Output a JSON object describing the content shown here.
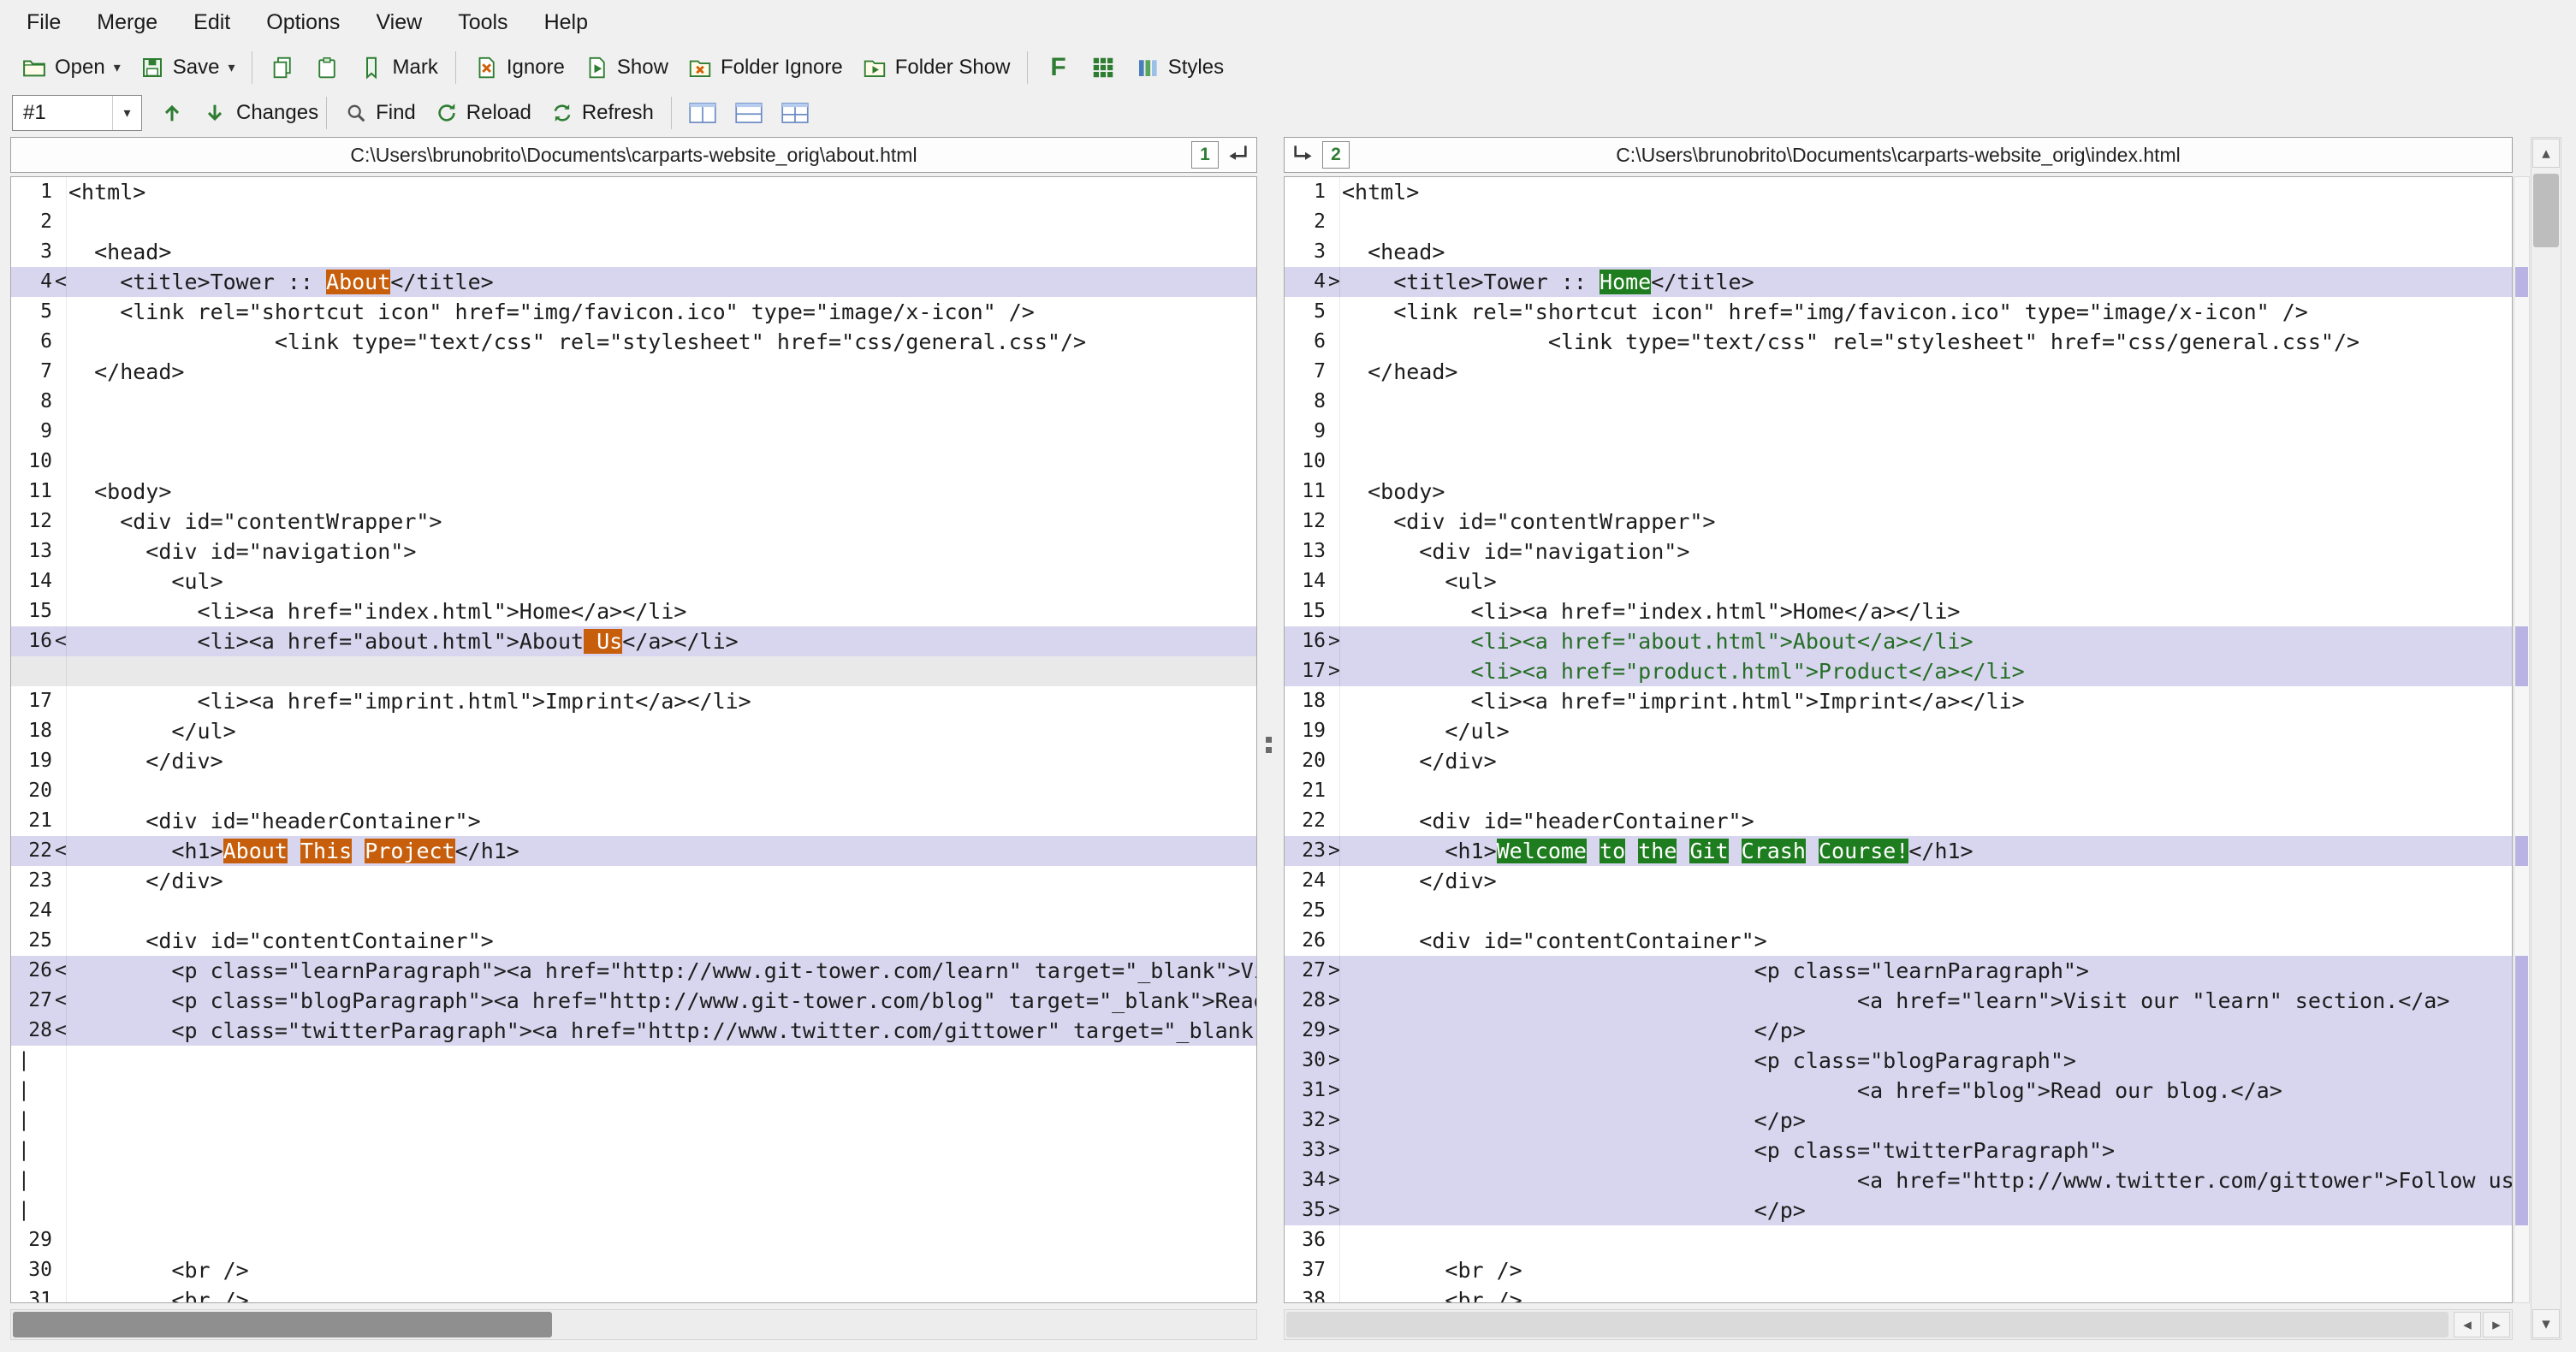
{
  "menu": [
    "File",
    "Merge",
    "Edit",
    "Options",
    "View",
    "Tools",
    "Help"
  ],
  "toolbar_main": {
    "open_label": "Open",
    "save_label": "Save",
    "mark_label": "Mark",
    "ignore_label": "Ignore",
    "show_label": "Show",
    "folder_ignore_label": "Folder Ignore",
    "folder_show_label": "Folder Show",
    "f_label": "F",
    "styles_label": "Styles"
  },
  "toolbar_nav": {
    "diff_selector_value": "#1",
    "changes_label": "Changes",
    "find_label": "Find",
    "reload_label": "Reload",
    "refresh_label": "Refresh"
  },
  "merge_links": {
    "pane1_badge": "1",
    "pane2_badge": "2"
  },
  "colors": {
    "diff_line_bg": "#d8d5ee",
    "gap_bg": "#e9e9e9",
    "removed_text_bg": "#c75e0c",
    "inserted_text_bg": "#1e7d1e",
    "inserted_line_text": "#256e25",
    "overview_mark": "#b9b3e3"
  },
  "left_pane": {
    "path": "C:\\Users\\brunobrito\\Documents\\carparts-website_orig\\about.html",
    "lines": [
      {
        "n": 1,
        "text": "<html>"
      },
      {
        "n": 2,
        "text": ""
      },
      {
        "n": 3,
        "text": "  <head>"
      },
      {
        "n": 4,
        "m": "<",
        "diff": true,
        "seg": [
          {
            "t": "    <title>Tower :: "
          },
          {
            "t": "About",
            "h": true
          },
          {
            "t": "</title>"
          }
        ]
      },
      {
        "n": 5,
        "text": "    <link rel=\"shortcut icon\" href=\"img/favicon.ico\" type=\"image/x-icon\" />"
      },
      {
        "n": 6,
        "text": "                <link type=\"text/css\" rel=\"stylesheet\" href=\"css/general.css\"/>"
      },
      {
        "n": 7,
        "text": "  </head>"
      },
      {
        "n": 8,
        "text": ""
      },
      {
        "n": 9,
        "text": ""
      },
      {
        "n": 10,
        "text": ""
      },
      {
        "n": 11,
        "text": "  <body>"
      },
      {
        "n": 12,
        "text": "    <div id=\"contentWrapper\">"
      },
      {
        "n": 13,
        "text": "      <div id=\"navigation\">"
      },
      {
        "n": 14,
        "text": "        <ul>"
      },
      {
        "n": 15,
        "text": "          <li><a href=\"index.html\">Home</a></li>"
      },
      {
        "n": 16,
        "m": "<",
        "diff": true,
        "seg": [
          {
            "t": "          <li><a href=\"about.html\">About"
          },
          {
            "t": " Us",
            "h": true
          },
          {
            "t": "</a></li>"
          }
        ]
      },
      {
        "gap": true
      },
      {
        "n": 17,
        "text": "          <li><a href=\"imprint.html\">Imprint</a></li>"
      },
      {
        "n": 18,
        "text": "        </ul>"
      },
      {
        "n": 19,
        "text": "      </div>"
      },
      {
        "n": 20,
        "text": ""
      },
      {
        "n": 21,
        "text": "      <div id=\"headerContainer\">"
      },
      {
        "n": 22,
        "m": "<",
        "diff": true,
        "seg": [
          {
            "t": "        <h1>"
          },
          {
            "t": "About",
            "h": true
          },
          {
            "t": " "
          },
          {
            "t": "This",
            "h": true
          },
          {
            "t": " "
          },
          {
            "t": "Project",
            "h": true
          },
          {
            "t": "</h1>"
          }
        ]
      },
      {
        "n": 23,
        "text": "      </div>"
      },
      {
        "n": 24,
        "text": ""
      },
      {
        "n": 25,
        "text": "      <div id=\"contentContainer\">"
      },
      {
        "n": 26,
        "m": "<",
        "diff": true,
        "text": "        <p class=\"learnParagraph\"><a href=\"http://www.git-tower.com/learn\" target=\"_blank\">Visit our \"learn\" section.</a></p>"
      },
      {
        "n": 27,
        "m": "<",
        "diff": true,
        "text": "        <p class=\"blogParagraph\"><a href=\"http://www.git-tower.com/blog\" target=\"_blank\">Read our blog.</a></p>"
      },
      {
        "n": 28,
        "m": "<",
        "diff": true,
        "text": "        <p class=\"twitterParagraph\"><a href=\"http://www.twitter.com/gittower\" target=\"_blank\">Follow us on Twitter.</a></p>"
      },
      {
        "gap": true,
        "bar": true
      },
      {
        "gap": true,
        "bar": true
      },
      {
        "gap": true,
        "bar": true
      },
      {
        "gap": true,
        "bar": true
      },
      {
        "gap": true,
        "bar": true
      },
      {
        "gap": true,
        "bar": true
      },
      {
        "n": 29,
        "text": ""
      },
      {
        "n": 30,
        "text": "        <br />"
      },
      {
        "n": 31,
        "text": "        <br />"
      }
    ]
  },
  "right_pane": {
    "path": "C:\\Users\\brunobrito\\Documents\\carparts-website_orig\\index.html",
    "lines": [
      {
        "n": 1,
        "text": "<html>"
      },
      {
        "n": 2,
        "text": ""
      },
      {
        "n": 3,
        "text": "  <head>"
      },
      {
        "n": 4,
        "m": ">",
        "diff": true,
        "seg": [
          {
            "t": "    <title>Tower :: "
          },
          {
            "t": "Home",
            "h": true
          },
          {
            "t": "</title>"
          }
        ]
      },
      {
        "n": 5,
        "text": "    <link rel=\"shortcut icon\" href=\"img/favicon.ico\" type=\"image/x-icon\" />"
      },
      {
        "n": 6,
        "text": "                <link type=\"text/css\" rel=\"stylesheet\" href=\"css/general.css\"/>"
      },
      {
        "n": 7,
        "text": "  </head>"
      },
      {
        "n": 8,
        "text": ""
      },
      {
        "n": 9,
        "text": ""
      },
      {
        "n": 10,
        "text": ""
      },
      {
        "n": 11,
        "text": "  <body>"
      },
      {
        "n": 12,
        "text": "    <div id=\"contentWrapper\">"
      },
      {
        "n": 13,
        "text": "      <div id=\"navigation\">"
      },
      {
        "n": 14,
        "text": "        <ul>"
      },
      {
        "n": 15,
        "text": "          <li><a href=\"index.html\">Home</a></li>"
      },
      {
        "n": 16,
        "m": ">",
        "diff": true,
        "ins": true,
        "text": "          <li><a href=\"about.html\">About</a></li>"
      },
      {
        "n": 17,
        "m": ">",
        "diff": true,
        "ins": true,
        "text": "          <li><a href=\"product.html\">Product</a></li>"
      },
      {
        "n": 18,
        "text": "          <li><a href=\"imprint.html\">Imprint</a></li>"
      },
      {
        "n": 19,
        "text": "        </ul>"
      },
      {
        "n": 20,
        "text": "      </div>"
      },
      {
        "n": 21,
        "text": ""
      },
      {
        "n": 22,
        "text": "      <div id=\"headerContainer\">"
      },
      {
        "n": 23,
        "m": ">",
        "diff": true,
        "seg": [
          {
            "t": "        <h1>"
          },
          {
            "t": "Welcome",
            "h": true
          },
          {
            "t": " "
          },
          {
            "t": "to",
            "h": true
          },
          {
            "t": " "
          },
          {
            "t": "the",
            "h": true
          },
          {
            "t": " "
          },
          {
            "t": "Git",
            "h": true
          },
          {
            "t": " "
          },
          {
            "t": "Crash",
            "h": true
          },
          {
            "t": " "
          },
          {
            "t": "Course!",
            "h": true
          },
          {
            "t": "</h1>"
          }
        ]
      },
      {
        "n": 24,
        "text": "      </div>"
      },
      {
        "n": 25,
        "text": ""
      },
      {
        "n": 26,
        "text": "      <div id=\"contentContainer\">"
      },
      {
        "n": 27,
        "m": ">",
        "diff": true,
        "text": "                                <p class=\"learnParagraph\">"
      },
      {
        "n": 28,
        "m": ">",
        "diff": true,
        "text": "                                        <a href=\"learn\">Visit our \"learn\" section.</a>"
      },
      {
        "n": 29,
        "m": ">",
        "diff": true,
        "text": "                                </p>"
      },
      {
        "n": 30,
        "m": ">",
        "diff": true,
        "text": "                                <p class=\"blogParagraph\">"
      },
      {
        "n": 31,
        "m": ">",
        "diff": true,
        "text": "                                        <a href=\"blog\">Read our blog.</a>"
      },
      {
        "n": 32,
        "m": ">",
        "diff": true,
        "text": "                                </p>"
      },
      {
        "n": 33,
        "m": ">",
        "diff": true,
        "text": "                                <p class=\"twitterParagraph\">"
      },
      {
        "n": 34,
        "m": ">",
        "diff": true,
        "text": "                                        <a href=\"http://www.twitter.com/gittower\">Follow us on Twitter.</a>"
      },
      {
        "n": 35,
        "m": ">",
        "diff": true,
        "text": "                                </p>"
      },
      {
        "n": 36,
        "text": ""
      },
      {
        "n": 37,
        "text": "        <br />"
      },
      {
        "n": 38,
        "text": "        <br />"
      }
    ]
  }
}
